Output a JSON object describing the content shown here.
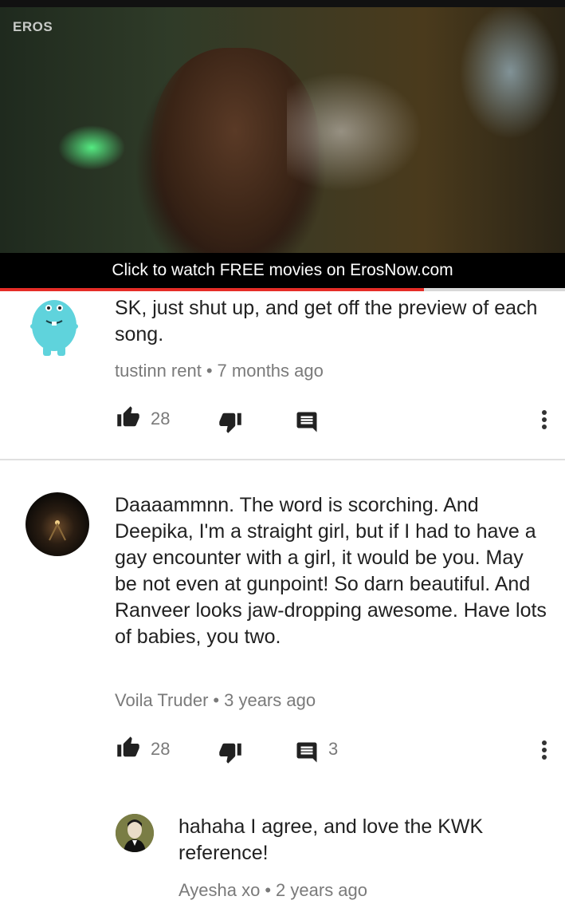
{
  "video": {
    "logo": "EROS",
    "banner_text": "Click to watch FREE movies on ErosNow.com",
    "progress": 0.75
  },
  "comments": [
    {
      "text": "SK, just shut up, and get off the preview of each song.",
      "author": "tustinn rent",
      "time": "7 months ago",
      "likes": "28",
      "replies": ""
    },
    {
      "text": "Daaaammnn. The word is scorching. And Deepika, I'm a straight girl, but if I had to have a gay encounter with a girl, it would be you. May be not even at gunpoint! So darn beautiful. And Ranveer looks jaw-dropping awesome. Have lots of babies, you two.",
      "author": "Voila Truder",
      "time": "3 years ago",
      "likes": "28",
      "replies": "3"
    }
  ],
  "reply": {
    "text": "hahaha I agree, and love the KWK reference!",
    "author": "Ayesha xo",
    "time": "2 years ago"
  },
  "icons": {
    "like": "thumbs-up-icon",
    "dislike": "thumbs-down-icon",
    "reply": "comment-icon",
    "more": "more-vertical-icon"
  },
  "colors": {
    "progress": "#e52d27",
    "meta_text": "#7a7a7a",
    "avatar_monster": "#5fd3dc"
  }
}
